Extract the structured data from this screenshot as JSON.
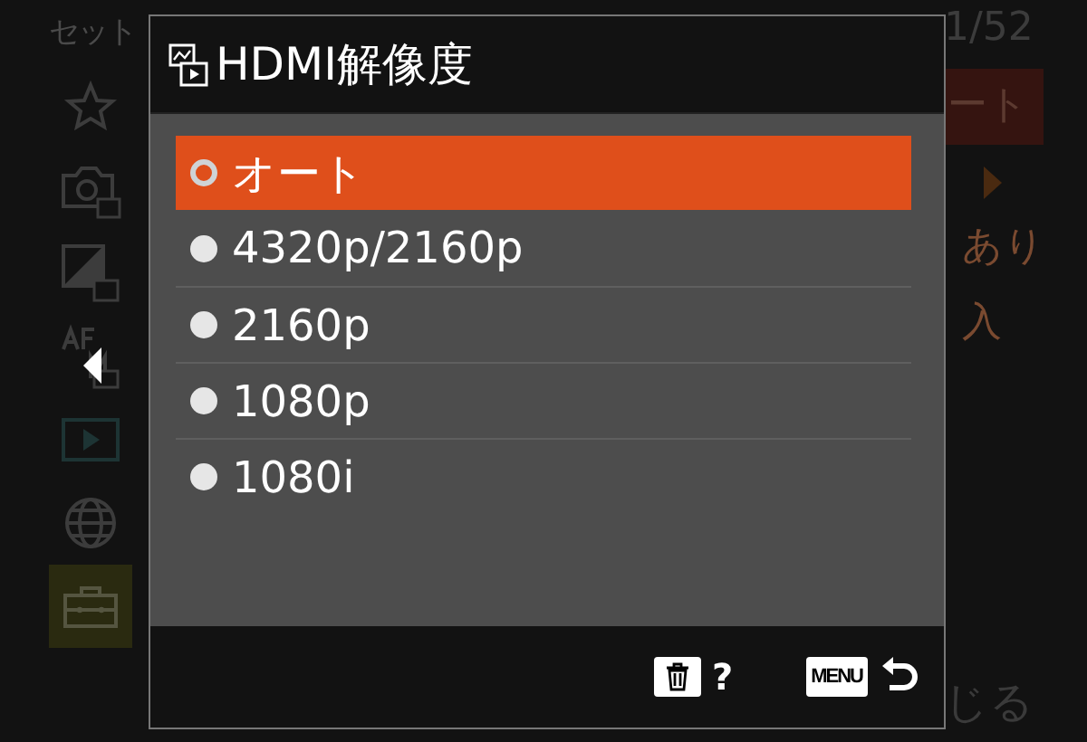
{
  "background": {
    "title": "セット",
    "page": "1/52",
    "side_items": [
      {
        "selected": false
      },
      {
        "selected": false
      },
      {
        "selected": false
      },
      {
        "selected": false
      },
      {
        "selected": false
      },
      {
        "selected": false
      },
      {
        "selected": true
      }
    ],
    "values": [
      {
        "kind": "chip",
        "text": "ート"
      },
      {
        "kind": "arrow"
      },
      {
        "kind": "text",
        "text": "あり"
      },
      {
        "kind": "text",
        "text": "入"
      }
    ],
    "footer_text": "じる"
  },
  "dialog": {
    "title": "HDMI解像度",
    "options": [
      {
        "label": "オート",
        "selected": true
      },
      {
        "label": "4320p/2160p",
        "selected": false
      },
      {
        "label": "2160p",
        "selected": false
      },
      {
        "label": "1080p",
        "selected": false
      },
      {
        "label": "1080i",
        "selected": false
      }
    ],
    "footer": {
      "help": "?",
      "menu_key": "MENU"
    }
  }
}
